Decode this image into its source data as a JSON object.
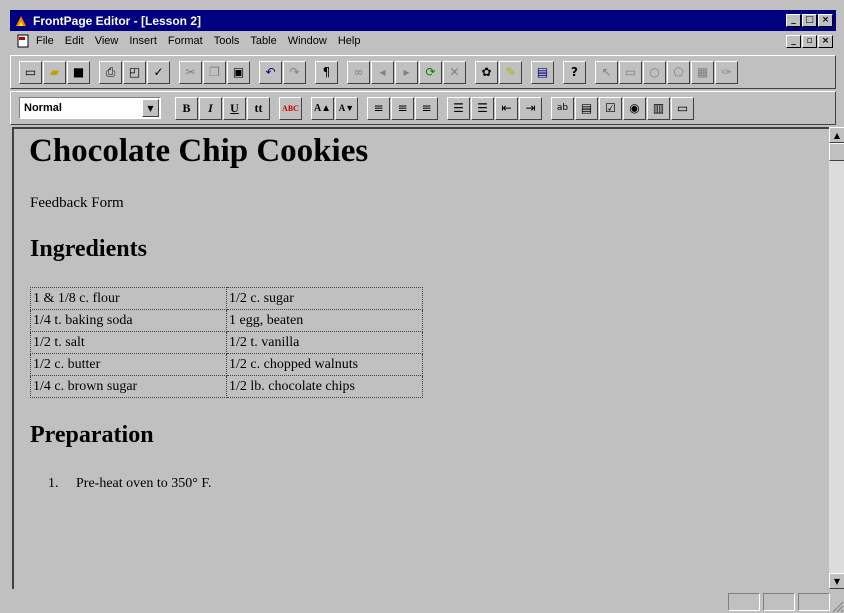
{
  "window": {
    "title": "FrontPage Editor - [Lesson 2]",
    "controls": [
      "_",
      "□",
      "×"
    ]
  },
  "menu": {
    "items": [
      "File",
      "Edit",
      "View",
      "Insert",
      "Format",
      "Tools",
      "Table",
      "Window",
      "Help"
    ],
    "mdi_controls": [
      "_",
      "▫",
      "×"
    ]
  },
  "toolbar_standard": {
    "buttons": [
      {
        "name": "new-icon",
        "glyph": "▭"
      },
      {
        "name": "open-icon",
        "glyph": "▰"
      },
      {
        "name": "save-icon",
        "glyph": "■"
      },
      {
        "name": "print-icon",
        "glyph": "⎙"
      },
      {
        "name": "print-preview-icon",
        "glyph": "◰"
      },
      {
        "name": "spelling-icon",
        "glyph": "✓"
      },
      {
        "name": "cut-icon",
        "glyph": "✂"
      },
      {
        "name": "copy-icon",
        "glyph": "❐"
      },
      {
        "name": "paste-icon",
        "glyph": "▣"
      },
      {
        "name": "undo-icon",
        "glyph": "↶"
      },
      {
        "name": "redo-icon",
        "glyph": "↷"
      },
      {
        "name": "show-paragraph-icon",
        "glyph": "¶"
      },
      {
        "name": "hyperlink-icon",
        "glyph": "∞"
      },
      {
        "name": "back-icon",
        "glyph": "◂"
      },
      {
        "name": "forward-icon",
        "glyph": "▸"
      },
      {
        "name": "refresh-icon",
        "glyph": "⟳"
      },
      {
        "name": "stop-icon",
        "glyph": "✕"
      },
      {
        "name": "webbot-icon",
        "glyph": "✿"
      },
      {
        "name": "highlight-icon",
        "glyph": "✎"
      },
      {
        "name": "show-explorer-icon",
        "glyph": "▤"
      },
      {
        "name": "help-icon",
        "glyph": "?"
      },
      {
        "name": "pointer-icon",
        "glyph": "↖"
      },
      {
        "name": "rectangle-icon",
        "glyph": "▭"
      },
      {
        "name": "circle-icon",
        "glyph": "○"
      },
      {
        "name": "polygon-icon",
        "glyph": "⬠"
      },
      {
        "name": "highlight-hotspots-icon",
        "glyph": "▦"
      },
      {
        "name": "make-transparent-icon",
        "glyph": "✑"
      }
    ]
  },
  "toolbar_format": {
    "style_value": "Normal",
    "buttons": [
      {
        "name": "bold-icon",
        "glyph": "B"
      },
      {
        "name": "italic-icon",
        "glyph": "I"
      },
      {
        "name": "underline-icon",
        "glyph": "U"
      },
      {
        "name": "fixed-width-icon",
        "glyph": "tt"
      },
      {
        "name": "text-color-icon",
        "glyph": "ABC"
      },
      {
        "name": "increase-text-size-icon",
        "glyph": "A▲"
      },
      {
        "name": "decrease-text-size-icon",
        "glyph": "A▼"
      },
      {
        "name": "align-left-icon",
        "glyph": "≡"
      },
      {
        "name": "align-center-icon",
        "glyph": "≡"
      },
      {
        "name": "align-right-icon",
        "glyph": "≡"
      },
      {
        "name": "numbered-list-icon",
        "glyph": "☰"
      },
      {
        "name": "bulleted-list-icon",
        "glyph": "☰"
      },
      {
        "name": "decrease-indent-icon",
        "glyph": "⇤"
      },
      {
        "name": "increase-indent-icon",
        "glyph": "⇥"
      },
      {
        "name": "one-line-textbox-icon",
        "glyph": "ab"
      },
      {
        "name": "scrolling-textbox-icon",
        "glyph": "▤"
      },
      {
        "name": "checkbox-icon",
        "glyph": "☑"
      },
      {
        "name": "radio-button-icon",
        "glyph": "◉"
      },
      {
        "name": "dropdown-menu-icon",
        "glyph": "▥"
      },
      {
        "name": "push-button-icon",
        "glyph": "▭"
      }
    ]
  },
  "document": {
    "heading": "Chocolate Chip Cookies",
    "feedback_text": "Feedback Form",
    "ingredients_heading": "Ingredients",
    "ingredients": [
      [
        "1 & 1/8 c. flour",
        "1/2 c. sugar"
      ],
      [
        "1/4 t. baking soda",
        "1 egg, beaten"
      ],
      [
        "1/2 t. salt",
        "1/2 t. vanilla"
      ],
      [
        "1/2 c. butter",
        "1/2 c. chopped walnuts"
      ],
      [
        "1/4 c. brown sugar",
        "1/2 lb. chocolate chips"
      ]
    ],
    "preparation_heading": "Preparation",
    "steps": [
      {
        "num": "1.",
        "text": "Pre-heat oven to 350° F."
      }
    ]
  },
  "colors": {
    "titlebar": "#000080",
    "face": "#c0c0c0"
  }
}
